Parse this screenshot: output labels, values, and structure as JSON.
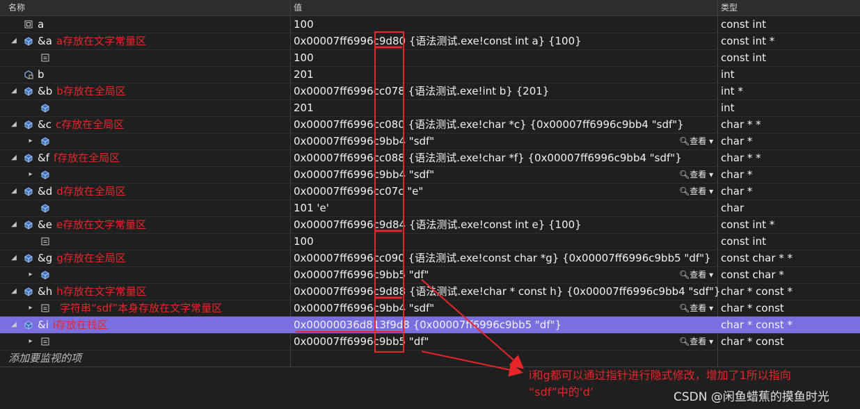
{
  "header": {
    "name": "名称",
    "value": "值",
    "type": "类型"
  },
  "rows": [
    {
      "exp": "",
      "icon": "local",
      "name": "a",
      "anno": "",
      "value": "100",
      "view": "",
      "type": "const int"
    },
    {
      "exp": "◢",
      "icon": "ptr",
      "name": "&a",
      "anno": "a存放在文字常量区",
      "value": "0x00007ff6996c9d80 {语法测试.exe!const int a} {100}",
      "view": "",
      "type": "const int *"
    },
    {
      "exp": "",
      "icon": "field",
      "name": "",
      "anno": "",
      "value": "100",
      "view": "",
      "type": "const int"
    },
    {
      "exp": "",
      "icon": "local2",
      "name": "b",
      "anno": "",
      "value": "201",
      "view": "",
      "type": "int"
    },
    {
      "exp": "◢",
      "icon": "ptr",
      "name": "&b",
      "anno": "b存放在全局区",
      "value": "0x00007ff6996cc078 {语法测试.exe!int b} {201}",
      "view": "",
      "type": "int *"
    },
    {
      "exp": "",
      "icon": "ptr",
      "name": "",
      "anno": "",
      "value": "201",
      "view": "",
      "type": "int"
    },
    {
      "exp": "◢",
      "icon": "ptr",
      "name": "&c",
      "anno": "c存放在全局区",
      "value": "0x00007ff6996cc080 {语法测试.exe!char  *c} {0x00007ff6996c9bb4 \"sdf\"}",
      "view": "",
      "type": "char * *"
    },
    {
      "exp": "▸",
      "icon": "ptr",
      "name": "",
      "anno": "",
      "value": "0x00007ff6996c9bb4 \"sdf\"",
      "view": "查看",
      "type": "char *"
    },
    {
      "exp": "◢",
      "icon": "ptr",
      "name": "&f",
      "anno": "f存放在全局区",
      "value": "0x00007ff6996cc088 {语法测试.exe!char  *f} {0x00007ff6996c9bb4 \"sdf\"}",
      "view": "",
      "type": "char * *"
    },
    {
      "exp": "▸",
      "icon": "ptr",
      "name": "",
      "anno": "",
      "value": "0x00007ff6996c9bb4 \"sdf\"",
      "view": "查看",
      "type": "char *"
    },
    {
      "exp": "◢",
      "icon": "ptr",
      "name": "&d",
      "anno": "d存放在全局区",
      "value": "0x00007ff6996cc07c \"e\"",
      "view": "查看",
      "type": "char *"
    },
    {
      "exp": "",
      "icon": "ptr",
      "name": "",
      "anno": "",
      "value": "101 'e'",
      "view": "",
      "type": "char"
    },
    {
      "exp": "◢",
      "icon": "ptr",
      "name": "&e",
      "anno": "e存放在文字常量区",
      "value": "0x00007ff6996c9d84 {语法测试.exe!const int e} {100}",
      "view": "",
      "type": "const int *"
    },
    {
      "exp": "",
      "icon": "field",
      "name": "",
      "anno": "",
      "value": "100",
      "view": "",
      "type": "const int"
    },
    {
      "exp": "◢",
      "icon": "ptr",
      "name": "&g",
      "anno": "g存放在全局区",
      "value": "0x00007ff6996cc090 {语法测试.exe!const char  *g} {0x00007ff6996c9bb5 \"df\"}",
      "view": "",
      "type": "const char * *"
    },
    {
      "exp": "▸",
      "icon": "ptr",
      "name": "",
      "anno": "",
      "value": "0x00007ff6996c9bb5 \"df\"",
      "view": "查看",
      "type": "const char *"
    },
    {
      "exp": "◢",
      "icon": "ptr",
      "name": "&h",
      "anno": "h存放在文字常量区",
      "value": "0x00007ff6996c9d88 {语法测试.exe!char  * const h} {0x00007ff6996c9bb4 \"sdf\"}",
      "view": "",
      "type": "char * const *"
    },
    {
      "exp": "▸",
      "icon": "field",
      "name": "",
      "anno": "字符串“sdf”本身存放在文字常量区",
      "value": "0x00007ff6996c9bb4 \"sdf\"",
      "view": "查看",
      "type": "char * const"
    },
    {
      "exp": "◢",
      "icon": "ptr",
      "name": "&i",
      "anno": "i存放在栈区",
      "value": "0x00000036d813f9d8 {0x00007ff6996c9bb5 \"df\"}",
      "view": "",
      "type": "char * const *",
      "selected": true
    },
    {
      "exp": "▸",
      "icon": "field",
      "name": "",
      "anno": "",
      "value": "0x00007ff6996c9bb5 \"df\"",
      "view": "查看",
      "type": "char * const"
    }
  ],
  "add_watch": "添加要监视的项",
  "note_line1": "i和g都可以通过指针进行隐式修改，增加了1所以指向",
  "note_line2": "“sdf”中的‘d’",
  "watermark": "CSDN @闲鱼蜡蕉的摸鱼时光",
  "colors": {
    "accent": "#e8262a",
    "selection": "#7b6fe0",
    "background": "#1f1f1f"
  }
}
